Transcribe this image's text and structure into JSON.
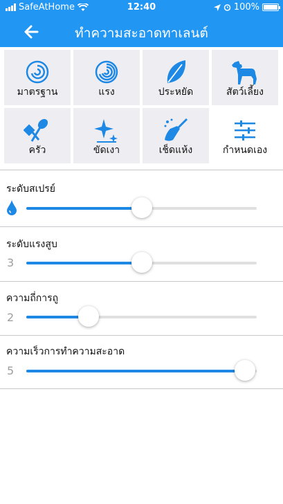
{
  "status_bar": {
    "carrier": "SafeAtHome",
    "time": "12:40",
    "battery": "100%"
  },
  "header": {
    "title": "ทำความสะอาดทาเลนต์"
  },
  "modes": [
    {
      "label": "มาตรฐาน",
      "icon": "swirl-icon",
      "selected": false
    },
    {
      "label": "แรง",
      "icon": "strong-swirl-icon",
      "selected": false
    },
    {
      "label": "ประหยัด",
      "icon": "leaf-icon",
      "selected": false
    },
    {
      "label": "สัตว์เลี้ยง",
      "icon": "dog-icon",
      "selected": false
    },
    {
      "label": "ครัว",
      "icon": "kitchen-utensils-icon",
      "selected": false
    },
    {
      "label": "ขัดเงา",
      "icon": "sparkle-icon",
      "selected": false
    },
    {
      "label": "เช็ดแห้ง",
      "icon": "broom-icon",
      "selected": false
    },
    {
      "label": "กำหนดเอง",
      "icon": "custom-sliders-icon",
      "selected": true
    }
  ],
  "settings": {
    "spray": {
      "label": "ระดับสเปรย์",
      "icon": "water-drop-icon",
      "level": 0.5
    },
    "suction": {
      "label": "ระดับแรงสูบ",
      "value": "3",
      "level": 0.5
    },
    "frequency": {
      "label": "ความถี่การถู",
      "value": "2",
      "level": 0.27
    },
    "speed": {
      "label": "ความเร็วการทำความสะอาด",
      "value": "5",
      "level": 0.95
    }
  },
  "colors": {
    "header": "#2196f3",
    "accent": "#1e88e5",
    "tile_bg": "#eeeef2"
  }
}
